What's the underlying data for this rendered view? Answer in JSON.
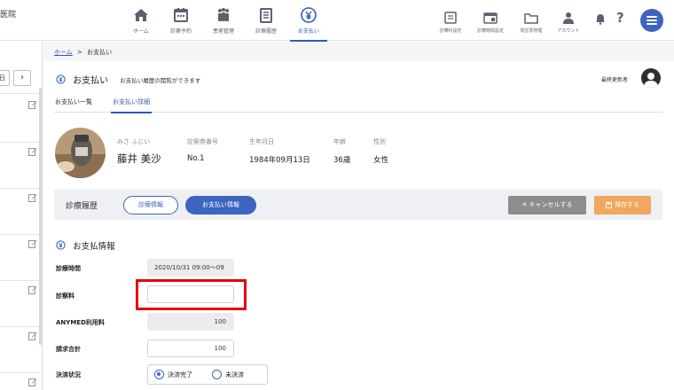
{
  "header": {
    "clinic_name_fragment": "医院",
    "nav": [
      {
        "label": "ホーム",
        "icon": "home-icon"
      },
      {
        "label": "診療予約",
        "icon": "calendar-icon"
      },
      {
        "label": "患者管理",
        "icon": "patients-icon"
      },
      {
        "label": "診療履歴",
        "icon": "history-icon"
      },
      {
        "label": "お支払い",
        "icon": "yen-icon",
        "active": true
      }
    ],
    "utilities": [
      {
        "label": "診療科設定",
        "icon": "department-settings-icon"
      },
      {
        "label": "診療時間設定",
        "icon": "hours-settings-icon"
      },
      {
        "label": "問診票管理",
        "icon": "questionnaire-folder-icon"
      },
      {
        "label": "アカウント",
        "icon": "account-icon"
      }
    ],
    "help_glyph": "?"
  },
  "left_panel": {
    "pager_partial": "日",
    "next_glyph": "›"
  },
  "breadcrumb": {
    "home": "ホーム",
    "separator": ">",
    "current": "お支払い"
  },
  "page": {
    "title": "お支払い",
    "description": "お支払い履歴の閲覧ができます",
    "updater_label": "最終更新者"
  },
  "tabs": [
    {
      "label": "お支払い一覧",
      "active": false
    },
    {
      "label": "お支払い詳細",
      "active": true
    }
  ],
  "patient": {
    "kana_label": "みさ ふじい",
    "name": "藤井 美沙",
    "card_no_label": "診察券番号",
    "card_no": "No.1",
    "birthdate_label": "生年月日",
    "birthdate": "1984年09月13日",
    "age_label": "年齢",
    "age": "36歳",
    "sex_label": "性別",
    "sex": "女性"
  },
  "action_bar": {
    "title": "診療履歴",
    "tab_medical_info": "診療情報",
    "tab_payment_info": "お支払い情報",
    "cancel_label": "✕ キャンセルする",
    "save_label": "保存する"
  },
  "payment": {
    "section_title": "お支払情報",
    "fields": {
      "time_label": "診療時間",
      "time_value": "2020/10/31  09:00〜09",
      "fee_label": "診察料",
      "fee_value": "",
      "anymed_label": "ANYMED利用料",
      "anymed_value": "100",
      "total_label": "請求合計",
      "total_value": "100",
      "status_label": "決済状況"
    },
    "status_options": [
      {
        "label": "決済完了",
        "checked": true
      },
      {
        "label": "未決済",
        "checked": false
      }
    ]
  },
  "colors": {
    "accent": "#3c64c0",
    "cancel": "#8d8d8d",
    "save": "#f2a65e",
    "highlight": "#e60012",
    "page_bg": "#f4f5f7"
  }
}
